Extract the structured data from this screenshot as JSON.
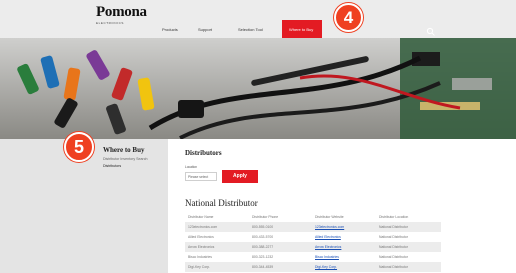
{
  "nav": {
    "logo": "Pomona",
    "logo_sub": "ELECTRONICS",
    "items": [
      "Products",
      "Support",
      "Selection Tool",
      "Where to Buy"
    ],
    "dropdown": [
      "Distributor Inventory Search",
      "Distributors"
    ]
  },
  "badges": {
    "four": "4",
    "five": "5"
  },
  "sidebar": {
    "title": "Where to Buy",
    "links": [
      "Distributor Inventory Search",
      "Distributors"
    ]
  },
  "main": {
    "title": "Distributors",
    "location_label": "Location",
    "location_placeholder": "Please select",
    "apply_label": "Apply",
    "national_title": "National Distributor",
    "columns": [
      "Distributor Name",
      "Distributor Phone",
      "Distributor Website",
      "Distributor Location"
    ],
    "rows": [
      [
        "123electronics.com",
        "800-555-0100",
        "123electronics.com",
        "National Distributor"
      ],
      [
        "Allied Electronics",
        "800-433-5700",
        "Allied Electronics",
        "National Distributor"
      ],
      [
        "Arrow Electronics",
        "800-388-2277",
        "Arrow Electronics",
        "National Distributor"
      ],
      [
        "Bisco Industries",
        "800-323-1232",
        "Bisco Industries",
        "National Distributor"
      ],
      [
        "Digi-Key Corp.",
        "800-344-4539",
        "Digi-Key Corp.",
        "National Distributor"
      ]
    ]
  },
  "colors": {
    "accent": "#e31b23",
    "badge": "#ef4021"
  }
}
